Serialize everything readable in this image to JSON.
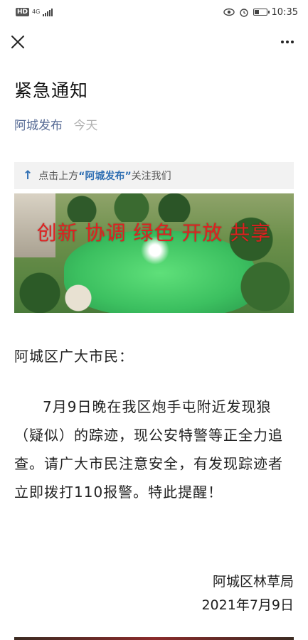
{
  "status_bar": {
    "hd_label": "HD",
    "network": "4G",
    "time": "10:35"
  },
  "article": {
    "title": "紧急通知",
    "author": "阿城发布",
    "date": "今天"
  },
  "follow_bar": {
    "prefix": "点击上方",
    "account": "“阿城发布”",
    "suffix": "关注我们"
  },
  "banner": {
    "slogan": "创新 协调 绿色 开放 共享"
  },
  "content": {
    "greeting": "阿城区广大市民：",
    "paragraph": "7月9日晚在我区炮手屯附近发现狼（疑似）的踪迹，现公安特警等正全力追查。请广大市民注意安全，有发现踪迹者立即拨打110报警。特此提醒！",
    "signature_org": "阿城区林草局",
    "signature_date": "2021年7月9日"
  },
  "icons": {
    "close": "close-icon",
    "more": "more-icon",
    "follow_arrow": "arrow-up-icon"
  },
  "colors": {
    "author_link": "#576b95",
    "accent_blue": "#2f6fb3",
    "slogan_red": "#e02020"
  }
}
